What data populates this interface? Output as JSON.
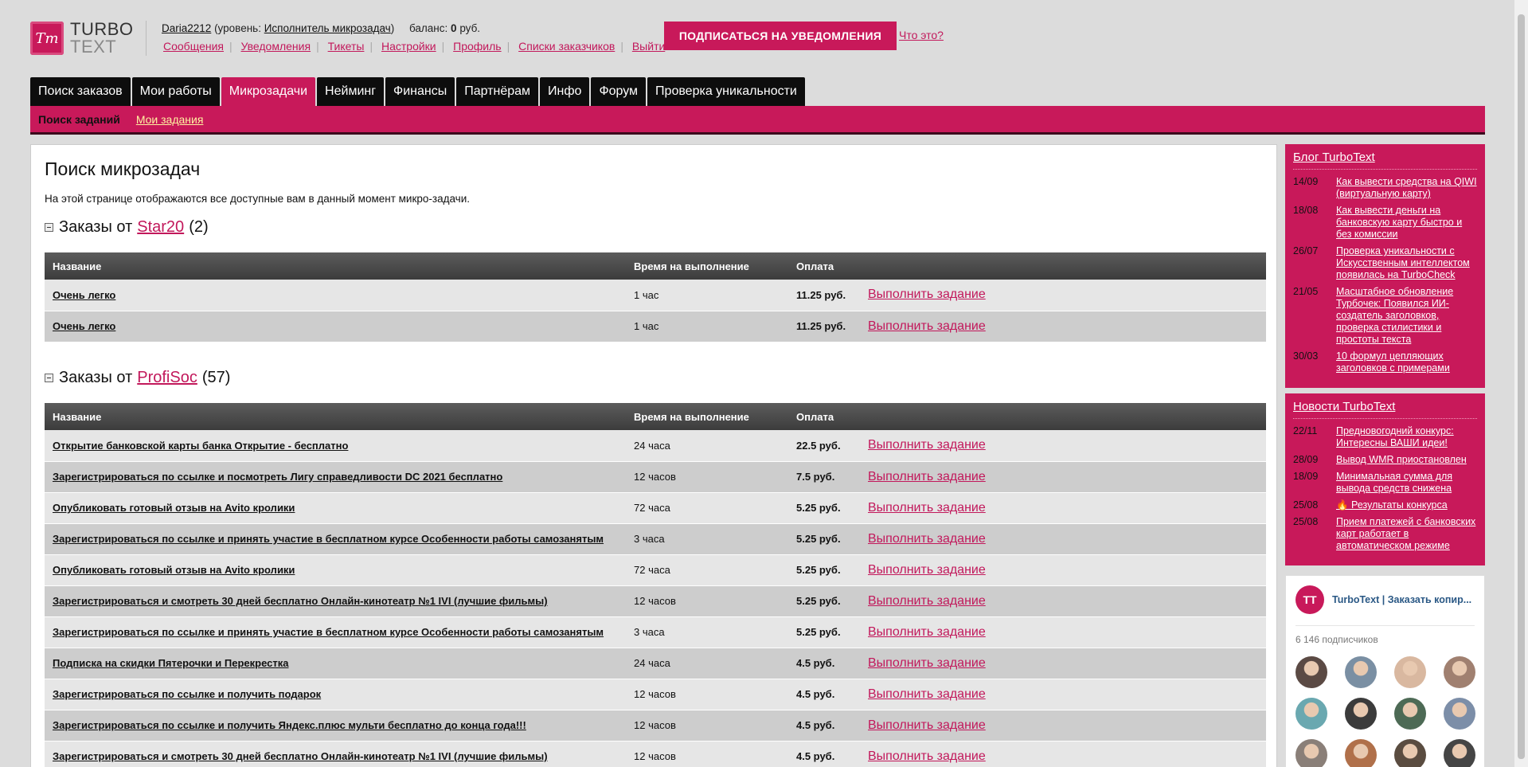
{
  "logo": {
    "mark": "Tт",
    "line1": "TURBO",
    "line2": "TEXT"
  },
  "user": {
    "name": "Daria2212",
    "level_prefix": "(уровень: ",
    "level": "Исполнитель микрозадач",
    "level_suffix": ")",
    "balance_label": "баланс:",
    "balance_value": "0",
    "balance_unit": "руб."
  },
  "nav_links": [
    "Сообщения",
    "Уведомления",
    "Тикеты",
    "Настройки",
    "Профиль",
    "Списки заказчиков",
    "Выйти"
  ],
  "subscribe_button": "ПОДПИСАТЬСЯ НА УВЕДОМЛЕНИЯ",
  "what_link": "Что это?",
  "tabs": [
    "Поиск заказов",
    "Мои работы",
    "Микрозадачи",
    "Нейминг",
    "Финансы",
    "Партнёрам",
    "Инфо",
    "Форум",
    "Проверка уникальности"
  ],
  "active_tab": "Микрозадачи",
  "subtabs": {
    "current": "Поиск заданий",
    "link": "Мои задания"
  },
  "page": {
    "title": "Поиск микрозадач",
    "description": "На этой странице отображаются все доступные вам в данный момент микро-задачи."
  },
  "columns": {
    "name": "Название",
    "time": "Время на выполнение",
    "pay": "Оплата"
  },
  "action_label": "Выполнить задание",
  "groups": [
    {
      "prefix": "Заказы от",
      "customer": "Star20",
      "count": "(2)",
      "rows": [
        {
          "name": "Очень легко",
          "time": "1 час",
          "pay": "11.25 руб."
        },
        {
          "name": "Очень легко",
          "time": "1 час",
          "pay": "11.25 руб."
        }
      ]
    },
    {
      "prefix": "Заказы от",
      "customer": "ProfiSoc",
      "count": "(57)",
      "rows": [
        {
          "name": "Открытие банковской карты банка Открытие - бесплатно",
          "time": "24 часа",
          "pay": "22.5 руб."
        },
        {
          "name": "Зарегистрироваться по ссылке и посмотреть Лигу справедливости DC 2021 бесплатно",
          "time": "12 часов",
          "pay": "7.5 руб."
        },
        {
          "name": "Опубликовать готовый отзыв на Avito кролики",
          "time": "72 часа",
          "pay": "5.25 руб."
        },
        {
          "name": "Зарегистрироваться по ссылке и принять участие в бесплатном курсе Особенности работы самозанятым",
          "time": "3 часа",
          "pay": "5.25 руб."
        },
        {
          "name": "Опубликовать готовый отзыв на Avito кролики",
          "time": "72 часа",
          "pay": "5.25 руб."
        },
        {
          "name": "Зарегистрироваться и смотреть 30 дней бесплатно Онлайн-кинотеатр №1 IVI (лучшие фильмы)",
          "time": "12 часов",
          "pay": "5.25 руб."
        },
        {
          "name": "Зарегистрироваться по ссылке и принять участие в бесплатном курсе Особенности работы самозанятым",
          "time": "3 часа",
          "pay": "5.25 руб."
        },
        {
          "name": "Подписка на скидки Пятерочки и Перекрестка",
          "time": "24 часа",
          "pay": "4.5 руб."
        },
        {
          "name": "Зарегистрироваться по ссылке и получить подарок",
          "time": "12 часов",
          "pay": "4.5 руб."
        },
        {
          "name": "Зарегистрироваться по ссылке и получить Яндекс.плюс мульти бесплатно до конца года!!!",
          "time": "12 часов",
          "pay": "4.5 руб."
        },
        {
          "name": "Зарегистрироваться и смотреть 30 дней бесплатно Онлайн-кинотеатр №1 IVI (лучшие фильмы)",
          "time": "12 часов",
          "pay": "4.5 руб."
        }
      ]
    }
  ],
  "blog": {
    "title": "Блог TurboText",
    "items": [
      {
        "date": "14/09",
        "text": "Как вывести средства на QIWI (виртуальную карту)"
      },
      {
        "date": "18/08",
        "text": "Как вывести деньги на банковскую карту быстро и без комиссии"
      },
      {
        "date": "26/07",
        "text": "Проверка уникальности с Искусственным интеллектом появилась на TurboCheck"
      },
      {
        "date": "21/05",
        "text": "Масштабное обновление Турбочек: Появился ИИ-создатель заголовков, проверка стилистики и простоты текста"
      },
      {
        "date": "30/03",
        "text": "10 формул цепляющих заголовков с примерами"
      }
    ]
  },
  "news": {
    "title": "Новости TurboText",
    "items": [
      {
        "date": "22/11",
        "text": "Предновогодний конкурс: Интересны ВАШИ идеи!"
      },
      {
        "date": "28/09",
        "text": "Вывод WMR приостановлен"
      },
      {
        "date": "18/09",
        "text": "Минимальная сумма для вывода средств снижена"
      },
      {
        "date": "25/08",
        "text": "🔥 Результаты конкурса"
      },
      {
        "date": "25/08",
        "text": "Прием платежей с банковских карт работает в автоматическом режиме"
      }
    ]
  },
  "vk": {
    "logo": "TT",
    "name": "TurboText | Заказать копир...",
    "subscribers": "6 146 подписчиков",
    "avatar_colors": [
      "#5b4a44",
      "#7a8fa3",
      "#d9b8a0",
      "#a08070",
      "#6aa8b0",
      "#3b3b3b",
      "#4d6a55",
      "#7c8ea8",
      "#8a7f78",
      "#b0704a",
      "#5a4c40",
      "#454545"
    ]
  }
}
